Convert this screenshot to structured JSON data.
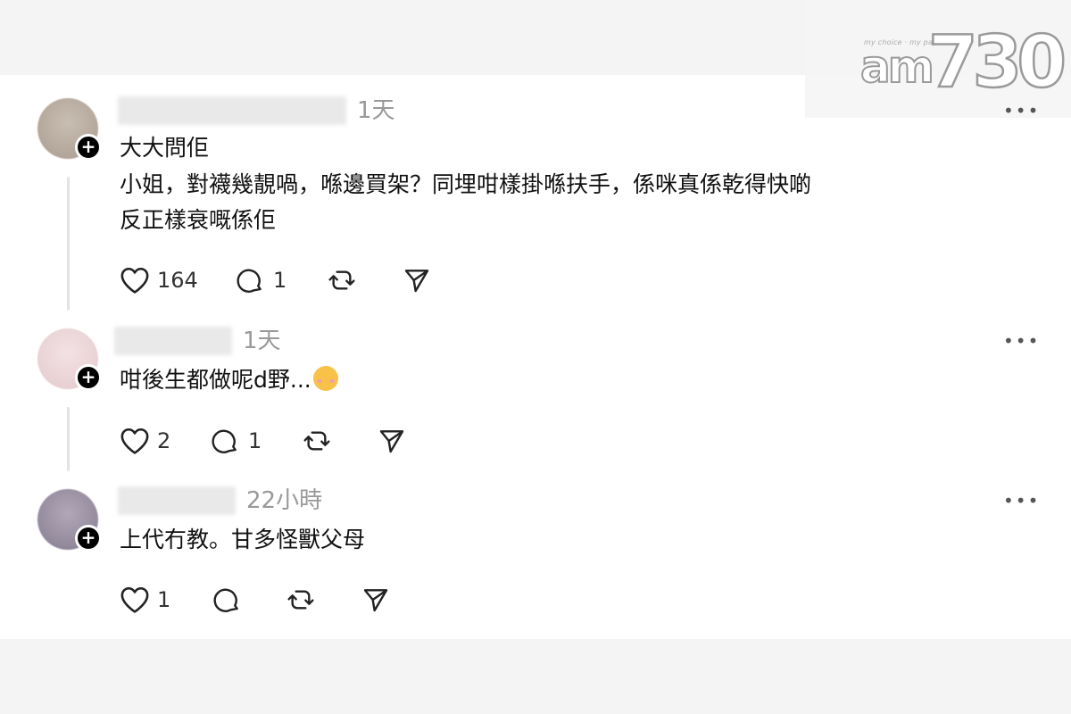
{
  "logo": {
    "tagline": "my choice · my paper",
    "am": "am",
    "num": "730"
  },
  "comments": [
    {
      "time": "1天",
      "more": "•••",
      "lines": [
        "大大問佢",
        "小姐，對襪幾靚喎，喺邊買架？同埋咁樣掛喺扶手，係咪真係乾得快啲",
        "反正樣衰嘅係佢"
      ],
      "likes": "164",
      "replies": "1",
      "avatar_color": "#b9aea3"
    },
    {
      "time": "1天",
      "more": "•••",
      "lines": [
        "咁後生都做呢d野..."
      ],
      "emoji": "face-emoji",
      "likes": "2",
      "replies": "1",
      "avatar_color": "#ecd6d8"
    },
    {
      "time": "22小時",
      "more": "•••",
      "lines": [
        "上代冇教。甘多怪獸父母"
      ],
      "likes": "1",
      "replies": "",
      "avatar_color": "#9a90a3"
    }
  ],
  "icons": {
    "like": "heart-icon",
    "reply": "comment-icon",
    "repost": "repost-icon",
    "share": "send-icon",
    "follow": "plus-icon",
    "more": "more-icon"
  }
}
